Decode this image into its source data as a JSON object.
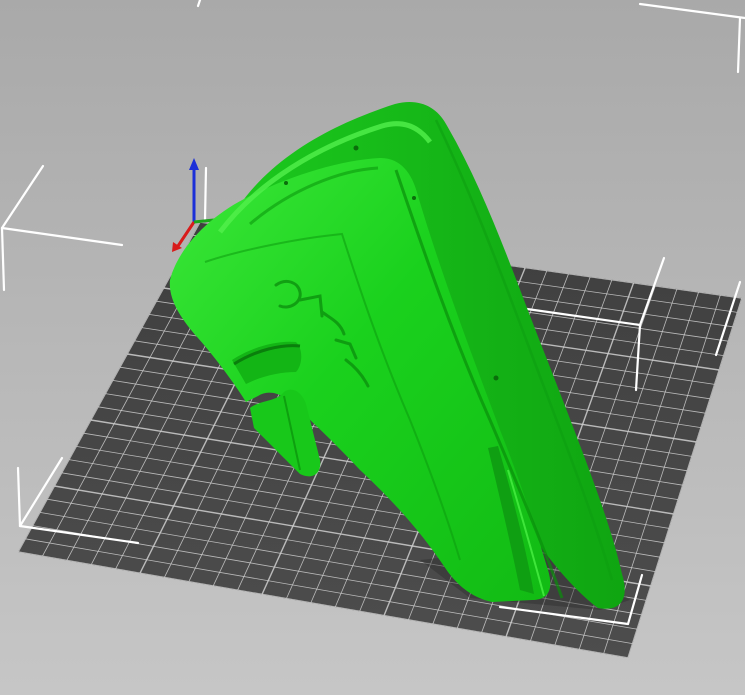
{
  "viewport": {
    "background_color": "#b7b7b7",
    "bed_color": "#4a4a4a",
    "grid_line_color": "#cfcfcf",
    "volume_edge_color": "#ffffff",
    "model_color": "#16d11a",
    "model_shadow_color": "#0a8f0c",
    "model_highlight_color": "#6cf55f",
    "axes": {
      "x_color": "#d81b1b",
      "y_color": "#1aa51a",
      "z_color": "#1b2fd8"
    },
    "icons": [
      "axes-gizmo-icon"
    ]
  }
}
